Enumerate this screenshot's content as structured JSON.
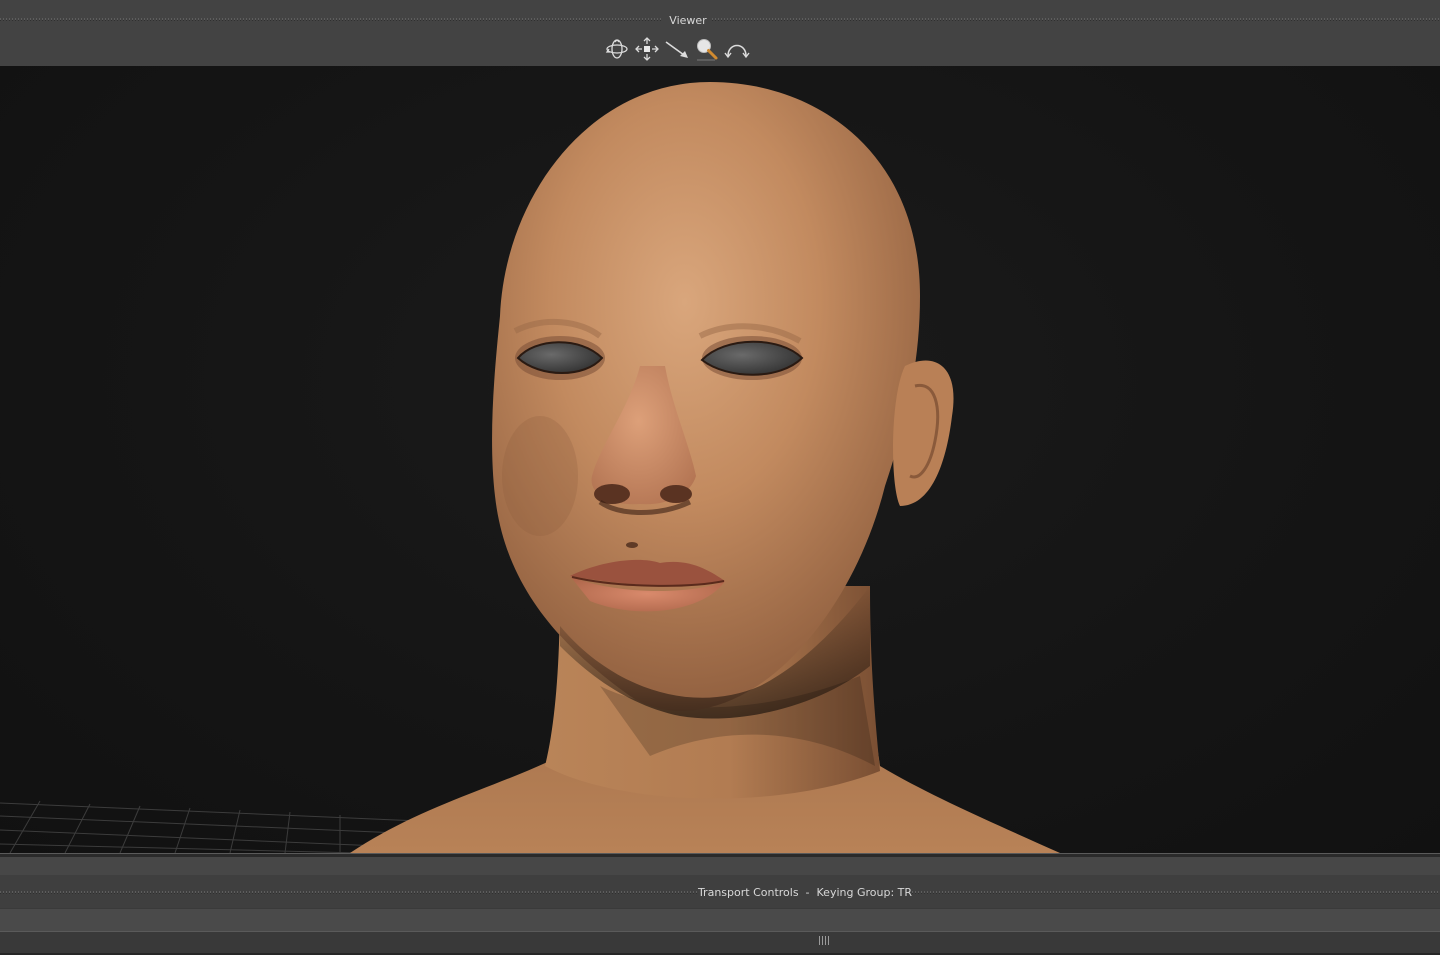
{
  "viewer": {
    "title": "Viewer",
    "tools": [
      {
        "name": "orbit-icon"
      },
      {
        "name": "pan-icon"
      },
      {
        "name": "dolly-icon"
      },
      {
        "name": "zoom-icon"
      },
      {
        "name": "arc-icon"
      }
    ]
  },
  "transport": {
    "title": "Transport Controls  -  Keying Group: TR"
  },
  "colors": {
    "panel": "#434343",
    "viewport_bg": "#151515",
    "text": "#d8d8d8",
    "skin": "#c48a60"
  }
}
